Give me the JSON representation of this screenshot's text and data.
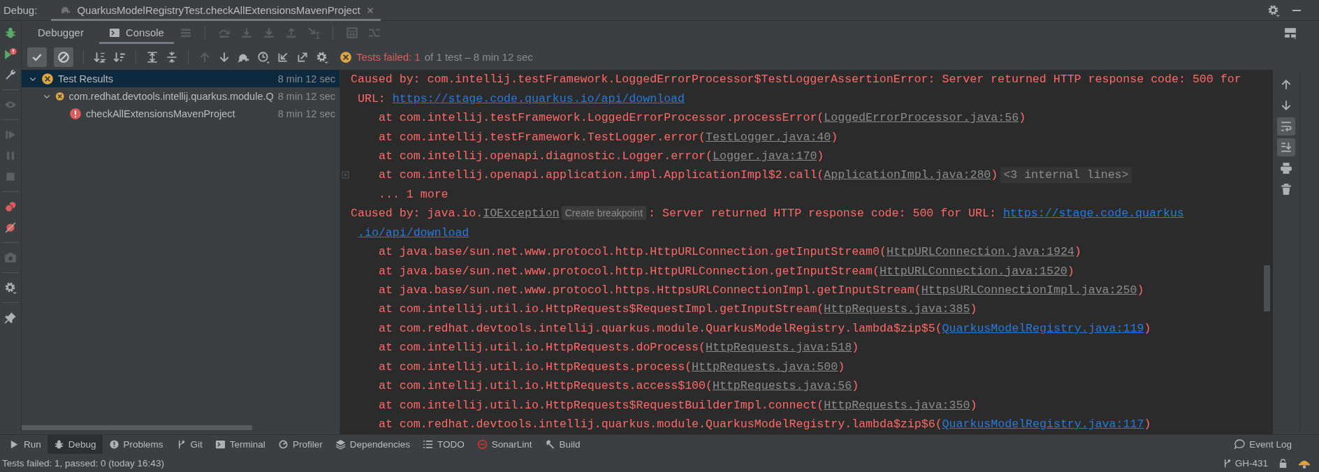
{
  "debug_bar": {
    "label": "Debug:",
    "tab": {
      "title": "QuarkusModelRegistryTest.checkAllExtensionsMavenProject"
    }
  },
  "tabs": [
    {
      "label": "Debugger",
      "selected": false
    },
    {
      "label": "Console",
      "selected": true
    }
  ],
  "test_toolbar": {
    "toggles": [
      {
        "kind": "passed",
        "selected": true
      },
      {
        "kind": "ignored",
        "selected": true
      }
    ],
    "status": {
      "failed_text": "Tests failed: 1",
      "summary": "of 1 test – 8 min 12 sec"
    }
  },
  "test_tree": [
    {
      "name": "Test Results",
      "time": "8 min 12 sec",
      "kind": "failed",
      "selected": true,
      "expanded": true,
      "children": [
        {
          "name": "com.redhat.devtools.intellij.quarkus.module.Q",
          "time": "8 min 12 sec",
          "kind": "failed",
          "selected": false,
          "expanded": true,
          "children": [
            {
              "name": "checkAllExtensionsMavenProject",
              "time": "8 min 12 sec",
              "kind": "error",
              "selected": false
            }
          ]
        }
      ]
    }
  ],
  "console": {
    "lines": [
      {
        "kind": "cause",
        "foldable": false,
        "segments": [
          {
            "kind": "text",
            "text": "Caused by: com.intellij.testFramework.LoggedErrorProcessor$TestLoggerAssertionError: Server returned HTTP response code: 500 for"
          }
        ]
      },
      {
        "kind": "continuation",
        "foldable": false,
        "segments": [
          {
            "kind": "text",
            "text": "URL: "
          },
          {
            "kind": "link",
            "text": "https://stage.code.quarkus.io/api/download"
          }
        ]
      },
      {
        "kind": "frame",
        "foldable": false,
        "segments": [
          {
            "kind": "text",
            "text": "at com.intellij.testFramework.LoggedErrorProcessor.processError("
          },
          {
            "kind": "file",
            "text": "LoggedErrorProcessor.java:56"
          },
          {
            "kind": "text",
            "text": ")"
          }
        ]
      },
      {
        "kind": "frame",
        "foldable": false,
        "segments": [
          {
            "kind": "text",
            "text": "at com.intellij.testFramework.TestLogger.error("
          },
          {
            "kind": "file",
            "text": "TestLogger.java:40"
          },
          {
            "kind": "text",
            "text": ")"
          }
        ]
      },
      {
        "kind": "frame",
        "foldable": false,
        "segments": [
          {
            "kind": "text",
            "text": "at com.intellij.openapi.diagnostic.Logger.error("
          },
          {
            "kind": "file",
            "text": "Logger.java:170"
          },
          {
            "kind": "text",
            "text": ")"
          }
        ]
      },
      {
        "kind": "frame",
        "foldable": true,
        "segments": [
          {
            "kind": "text",
            "text": "at com.intellij.openapi.application.impl.ApplicationImpl$2.call("
          },
          {
            "kind": "file",
            "text": "ApplicationImpl.java:280"
          },
          {
            "kind": "text",
            "text": ")"
          },
          {
            "kind": "folded",
            "text": "<3 internal lines>"
          }
        ]
      },
      {
        "kind": "frame",
        "foldable": false,
        "segments": [
          {
            "kind": "text",
            "text": "... 1 more"
          }
        ]
      },
      {
        "kind": "cause",
        "foldable": false,
        "segments": [
          {
            "kind": "text",
            "text": "Caused by: java.io."
          },
          {
            "kind": "file",
            "text": "IOException"
          },
          {
            "kind": "hint",
            "text": "Create breakpoint"
          },
          {
            "kind": "text",
            "text": ": Server returned HTTP response code: 500 for URL: "
          },
          {
            "kind": "link",
            "text": "https://stage.code.quarkus"
          }
        ]
      },
      {
        "kind": "continuation",
        "foldable": false,
        "segments": [
          {
            "kind": "link",
            "text": ".io/api/download"
          }
        ]
      },
      {
        "kind": "frame",
        "foldable": false,
        "segments": [
          {
            "kind": "text",
            "text": "at java.base/sun.net.www.protocol.http.HttpURLConnection.getInputStream0("
          },
          {
            "kind": "file",
            "text": "HttpURLConnection.java:1924"
          },
          {
            "kind": "text",
            "text": ")"
          }
        ]
      },
      {
        "kind": "frame",
        "foldable": false,
        "segments": [
          {
            "kind": "text",
            "text": "at java.base/sun.net.www.protocol.http.HttpURLConnection.getInputStream("
          },
          {
            "kind": "file",
            "text": "HttpURLConnection.java:1520"
          },
          {
            "kind": "text",
            "text": ")"
          }
        ]
      },
      {
        "kind": "frame",
        "foldable": false,
        "segments": [
          {
            "kind": "text",
            "text": "at java.base/sun.net.www.protocol.https.HttpsURLConnectionImpl.getInputStream("
          },
          {
            "kind": "file",
            "text": "HttpsURLConnectionImpl.java:250"
          },
          {
            "kind": "text",
            "text": ")"
          }
        ]
      },
      {
        "kind": "frame",
        "foldable": false,
        "segments": [
          {
            "kind": "text",
            "text": "at com.intellij.util.io.HttpRequests$RequestImpl.getInputStream("
          },
          {
            "kind": "file",
            "text": "HttpRequests.java:385"
          },
          {
            "kind": "text",
            "text": ")"
          }
        ]
      },
      {
        "kind": "frame",
        "foldable": false,
        "segments": [
          {
            "kind": "text",
            "text": "at com.redhat.devtools.intellij.quarkus.module.QuarkusModelRegistry.lambda$zip$5("
          },
          {
            "kind": "link",
            "text": "QuarkusModelRegistry.java:119"
          },
          {
            "kind": "text",
            "text": ")"
          }
        ]
      },
      {
        "kind": "frame",
        "foldable": false,
        "segments": [
          {
            "kind": "text",
            "text": "at com.intellij.util.io.HttpRequests.doProcess("
          },
          {
            "kind": "file",
            "text": "HttpRequests.java:518"
          },
          {
            "kind": "text",
            "text": ")"
          }
        ]
      },
      {
        "kind": "frame",
        "foldable": false,
        "segments": [
          {
            "kind": "text",
            "text": "at com.intellij.util.io.HttpRequests.process("
          },
          {
            "kind": "file",
            "text": "HttpRequests.java:500"
          },
          {
            "kind": "text",
            "text": ")"
          }
        ]
      },
      {
        "kind": "frame",
        "foldable": false,
        "segments": [
          {
            "kind": "text",
            "text": "at com.intellij.util.io.HttpRequests.access$100("
          },
          {
            "kind": "file",
            "text": "HttpRequests.java:56"
          },
          {
            "kind": "text",
            "text": ")"
          }
        ]
      },
      {
        "kind": "frame",
        "foldable": false,
        "segments": [
          {
            "kind": "text",
            "text": "at com.intellij.util.io.HttpRequests$RequestBuilderImpl.connect("
          },
          {
            "kind": "file",
            "text": "HttpRequests.java:350"
          },
          {
            "kind": "text",
            "text": ")"
          }
        ]
      },
      {
        "kind": "frame",
        "foldable": false,
        "segments": [
          {
            "kind": "text",
            "text": "at com.redhat.devtools.intellij.quarkus.module.QuarkusModelRegistry.lambda$zip$6("
          },
          {
            "kind": "link",
            "text": "QuarkusModelRegistry.java:117"
          },
          {
            "kind": "text",
            "text": ")"
          }
        ]
      }
    ]
  },
  "console_toolbar": [
    {
      "kind": "up",
      "on": false
    },
    {
      "kind": "down",
      "on": false
    },
    {
      "kind": "soft_wrap",
      "on": true
    },
    {
      "kind": "scroll_end",
      "on": true
    },
    {
      "kind": "print",
      "on": false
    },
    {
      "kind": "clear",
      "on": false
    }
  ],
  "tool_windows": [
    {
      "kind": "run",
      "label": "Run",
      "selected": false
    },
    {
      "kind": "debug",
      "label": "Debug",
      "selected": true
    },
    {
      "kind": "problems",
      "label": "Problems",
      "selected": false
    },
    {
      "kind": "git",
      "label": "Git",
      "selected": false
    },
    {
      "kind": "terminal",
      "label": "Terminal",
      "selected": false
    },
    {
      "kind": "profiler",
      "label": "Profiler",
      "selected": false
    },
    {
      "kind": "dependencies",
      "label": "Dependencies",
      "selected": false
    },
    {
      "kind": "todo",
      "label": "TODO",
      "selected": false
    },
    {
      "kind": "sonarlint",
      "label": "SonarLint",
      "selected": false
    },
    {
      "kind": "build",
      "label": "Build",
      "selected": false
    }
  ],
  "event_log": "Event Log",
  "status_bar": {
    "message": "Tests failed: 1, passed: 0 (today 16:43)",
    "branch": "GH-431"
  }
}
